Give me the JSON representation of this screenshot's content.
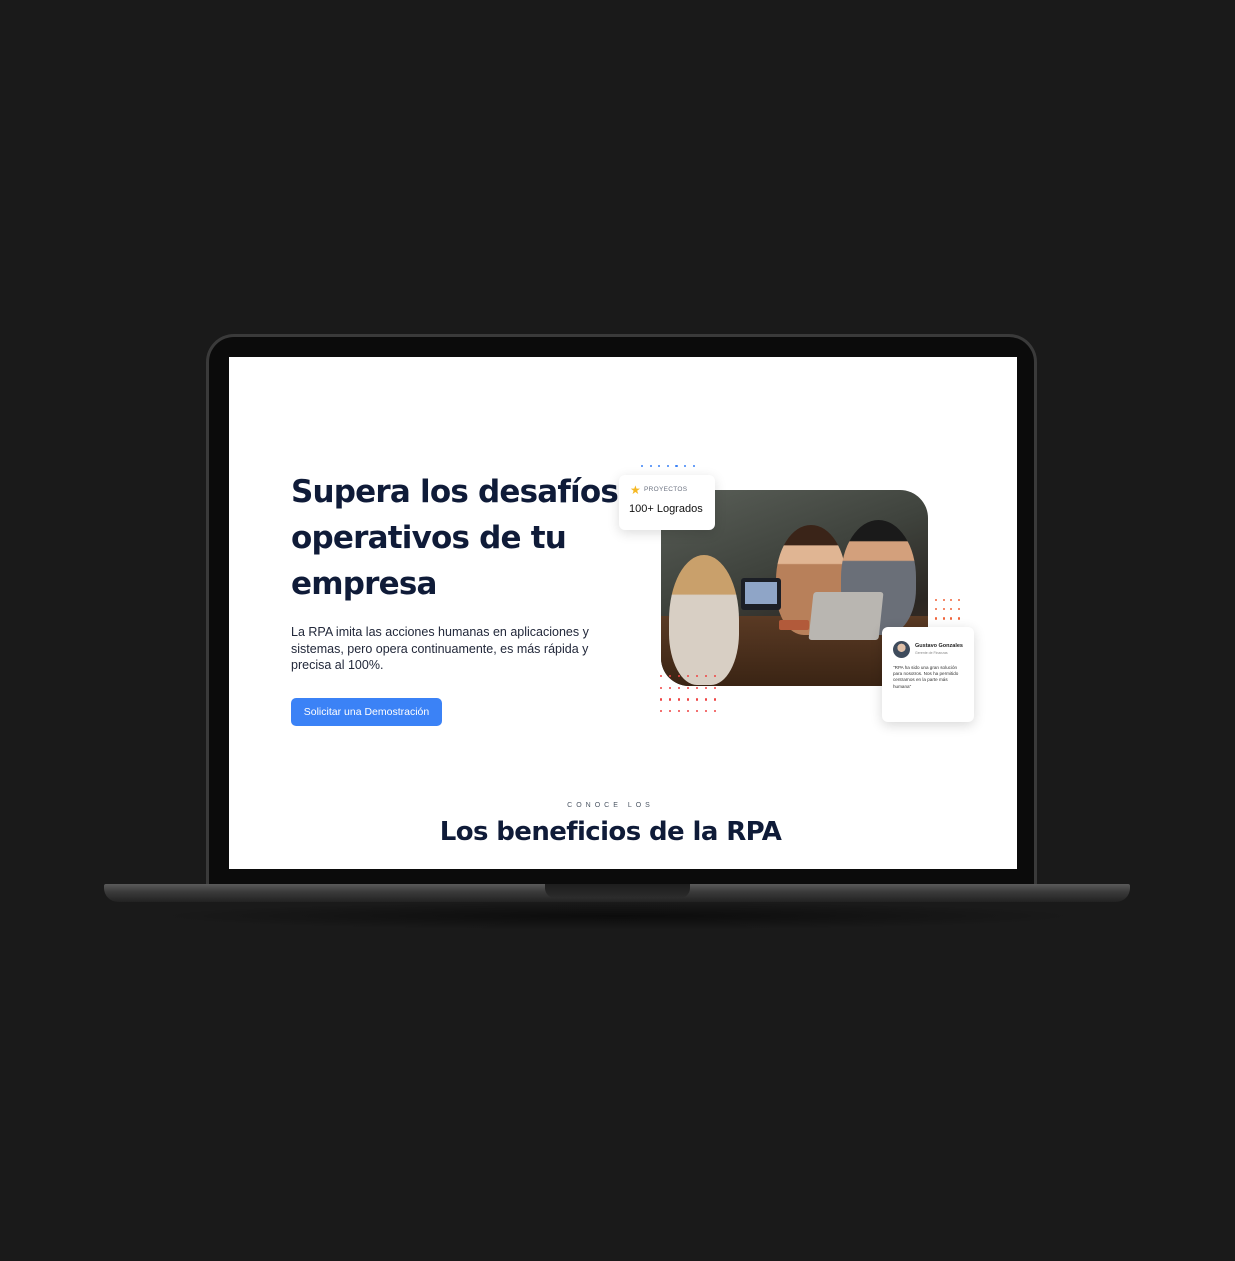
{
  "hero": {
    "title": "Supera los desafíos operativos de tu empresa",
    "description": "La RPA imita las acciones humanas en aplicaciones y sistemas, pero opera continuamente, es más rápida y precisa al 100%.",
    "cta_label": "Solicitar una Demostración"
  },
  "stat_card": {
    "icon": "star-icon",
    "label": "PROYECTOS",
    "value": "100+ Logrados"
  },
  "testimonial": {
    "name": "Gustavo Gonzales",
    "role": "Gerente de Finanzas",
    "quote": "\"RPA ha sido una gran solución para nosotros. Nos ha permitido centrarnos en la parte más humana\""
  },
  "benefits": {
    "eyebrow": "CONOCE LOS",
    "title": "Los beneficios de la RPA"
  },
  "colors": {
    "accent": "#3b82f6",
    "heading": "#0f1b38",
    "dots_orange": "#f0643a",
    "dots_red": "#ef4444",
    "background": "#1a1a1a"
  }
}
